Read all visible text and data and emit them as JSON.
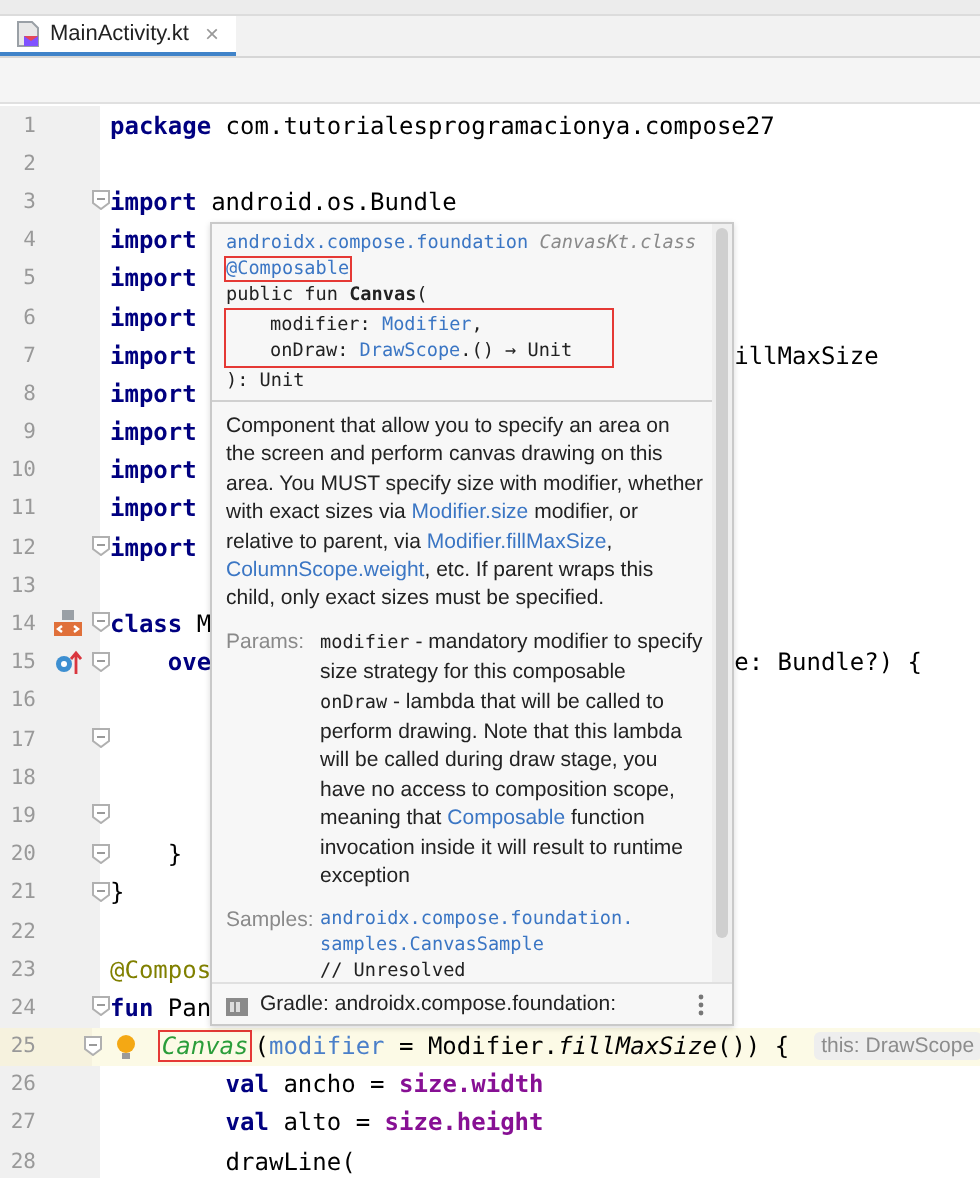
{
  "tab": {
    "label": "MainActivity.kt",
    "selected": true,
    "close": "×"
  },
  "lines": [
    {
      "number": "1",
      "tokens": [
        {
          "kind": "kw",
          "t": "package"
        },
        {
          "kind": "plain",
          "t": " com.tutorialesprogramacionya.compose27"
        }
      ]
    },
    {
      "number": "2"
    },
    {
      "number": "3",
      "fold": true,
      "tokens": [
        {
          "kind": "kw",
          "t": "import"
        },
        {
          "kind": "plain",
          "t": " android.os.Bundle"
        }
      ]
    },
    {
      "number": "4",
      "tokens": [
        {
          "kind": "kw",
          "t": "import"
        }
      ]
    },
    {
      "number": "5",
      "tokens": [
        {
          "kind": "kw",
          "t": "import"
        }
      ]
    },
    {
      "number": "6",
      "tokens": [
        {
          "kind": "kw",
          "t": "import"
        }
      ]
    },
    {
      "number": "7",
      "tokens": [
        {
          "kind": "kw",
          "t": "import"
        }
      ],
      "tail": [
        "illMaxSize"
      ]
    },
    {
      "number": "8",
      "tokens": [
        {
          "kind": "kw",
          "t": "import"
        }
      ]
    },
    {
      "number": "9",
      "tokens": [
        {
          "kind": "kw",
          "t": "import"
        }
      ]
    },
    {
      "number": "10",
      "tokens": [
        {
          "kind": "kw",
          "t": "import"
        }
      ]
    },
    {
      "number": "11",
      "tokens": [
        {
          "kind": "kw",
          "t": "import"
        }
      ]
    },
    {
      "number": "12",
      "fold": true,
      "tokens": [
        {
          "kind": "kw",
          "t": "import"
        }
      ]
    },
    {
      "number": "13"
    },
    {
      "number": "14",
      "kind": "class",
      "fold": true,
      "tokens": [
        {
          "kind": "kw",
          "t": "class"
        },
        {
          "kind": "plain",
          "t": " M"
        }
      ],
      "children": [
        {
          "number": "15",
          "kind": "override",
          "fold": true,
          "tokens": [
            {
              "kind": "kw",
              "t": "ove"
            }
          ],
          "tail": [
            "e: Bundle?) {"
          ],
          "children": [
            {
              "number": "16"
            },
            {
              "number": "17",
              "fold": true
            },
            {
              "number": "18"
            },
            {
              "number": "19",
              "fold": true
            }
          ]
        },
        {
          "number": "20",
          "fold": true,
          "tokens": [
            {
              "kind": "plain",
              "t": "}"
            }
          ]
        }
      ]
    },
    {
      "number": "21",
      "fold": true,
      "tokens": [
        {
          "kind": "plain",
          "t": "}"
        }
      ]
    },
    {
      "number": "22"
    },
    {
      "number": "23",
      "tokens": [
        {
          "kind": "annot",
          "t": "@Compos"
        }
      ]
    },
    {
      "number": "24",
      "fold": true,
      "tokens": [
        {
          "kind": "kw",
          "t": "fun"
        },
        {
          "kind": "plain",
          "t": " Pan"
        }
      ],
      "children": [
        {
          "number": "25",
          "fold": true,
          "current": true,
          "bulb": true,
          "hint": "this: DrawScope",
          "tokens": [
            {
              "kind": "call",
              "t": "Canvas",
              "boxed": true
            },
            {
              "kind": "plain",
              "t": "("
            },
            {
              "kind": "arg",
              "t": "modifier"
            },
            {
              "kind": "plain",
              "t": " = Modifier."
            },
            {
              "kind": "ital",
              "t": "fillMaxSize"
            },
            {
              "kind": "plain",
              "t": "()) {"
            }
          ],
          "children": [
            {
              "number": "26",
              "tokens": [
                {
                  "kind": "kw",
                  "t": "val"
                },
                {
                  "kind": "plain",
                  "t": " ancho = "
                },
                {
                  "kind": "prop",
                  "t": "size.width"
                }
              ]
            },
            {
              "number": "27",
              "tokens": [
                {
                  "kind": "kw",
                  "t": "val"
                },
                {
                  "kind": "plain",
                  "t": " alto = "
                },
                {
                  "kind": "prop",
                  "t": "size.height"
                }
              ]
            },
            {
              "number": "28",
              "tokens": [
                {
                  "kind": "plain",
                  "t": "drawLine("
                }
              ]
            }
          ]
        }
      ]
    }
  ],
  "popup": {
    "package": "androidx.compose.foundation",
    "file": "CanvasKt.class",
    "annotation": {
      "text": "@Composable",
      "boxed": true
    },
    "signature": {
      "prefix": "public fun ",
      "name": "Canvas",
      "suffix": "("
    },
    "params_box": {
      "boxed": true,
      "lines": [
        [
          {
            "kind": "name",
            "t": "modifier: "
          },
          {
            "kind": "type",
            "t": "Modifier"
          },
          {
            "kind": "name",
            "t": ","
          }
        ],
        [
          {
            "kind": "name",
            "t": "onDraw: "
          },
          {
            "kind": "type",
            "t": "DrawScope"
          },
          {
            "kind": "name",
            "t": ".() → Unit"
          }
        ]
      ]
    },
    "close": "): Unit",
    "description": [
      {
        "kind": "text",
        "t": "Component that allow you to specify an area on the screen and perform canvas drawing on this area. You MUST specify size with modifier, whether with exact sizes via "
      },
      {
        "kind": "link",
        "t": "Modifier.size"
      },
      {
        "kind": "text",
        "t": " modifier, or relative to parent, via "
      },
      {
        "kind": "link",
        "t": "Modifier.fillMaxSize"
      },
      {
        "kind": "text",
        "t": ", "
      },
      {
        "kind": "link",
        "t": "ColumnScope.weight"
      },
      {
        "kind": "text",
        "t": ", etc. If parent wraps this child, only exact sizes must be specified."
      }
    ],
    "params_label": "Params:",
    "params": [
      {
        "name": "modifier",
        "text": [
          {
            "kind": "text",
            "t": " - mandatory modifier to specify size strategy for this composable"
          }
        ]
      },
      {
        "name": "onDraw",
        "text": [
          {
            "kind": "text",
            "t": " - lambda that will be called to perform drawing. Note that this lambda will be called during draw stage, you have no access to composition scope, meaning that "
          },
          {
            "kind": "link",
            "t": "Composable"
          },
          {
            "kind": "text",
            "t": " function invocation inside it will result to runtime exception"
          }
        ]
      }
    ],
    "samples_label": "Samples:",
    "samples": [
      "androidx.compose.foundation.",
      "samples.CanvasSample"
    ],
    "samples_note": "// Unresolved",
    "footer": "Gradle: androidx.compose.foundation:"
  }
}
